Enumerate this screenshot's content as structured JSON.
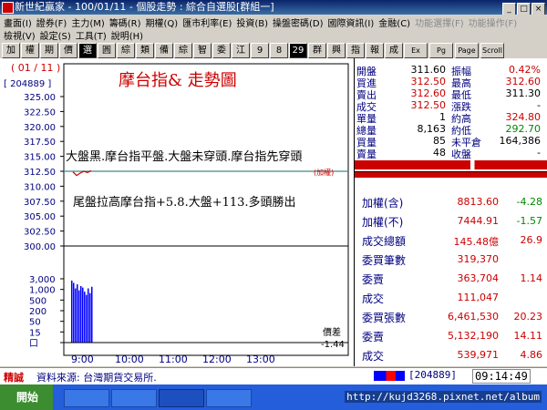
{
  "window": {
    "title": "新世紀贏家 - 100/01/11 - 個股走勢 : 綜合自選股[群組一]",
    "min_btn": "_",
    "max_btn": "□",
    "close_btn": "×"
  },
  "menu": {
    "row1": [
      "畫面(I)",
      "證券(F)",
      "主力(M)",
      "籌碼(R)",
      "期權(Q)",
      "匯市利率(E)",
      "投資(B)",
      "操盤密碼(D)",
      "國際資訊(I)",
      "金融(C)",
      "功能選擇(F)",
      "功能操作(F)"
    ],
    "row2": [
      "檢視(V)",
      "設定(S)",
      "工具(T)",
      "說明(H)"
    ]
  },
  "toolbar": {
    "buttons": [
      "加",
      "權",
      "期",
      "價",
      "選",
      "圓",
      "綜",
      "類",
      "備",
      "綜",
      "智",
      "委",
      "江",
      "9",
      "8",
      "29",
      "群",
      "興",
      "指",
      "報",
      "成",
      "Ex",
      "Pg",
      "Page",
      "Scroll"
    ]
  },
  "chart": {
    "date_label": "( 01 / 11 )",
    "code_label": "[ 204889 ]",
    "title": "摩台指&  走勢圖",
    "price_ticks": [
      "325.00",
      "322.50",
      "320.00",
      "317.50",
      "315.00",
      "312.50",
      "310.00",
      "307.50",
      "305.00",
      "302.50",
      "300.00"
    ],
    "volume_ticks": [
      "3,000",
      "1,000",
      "500",
      "200",
      "50",
      "15",
      "口"
    ],
    "time_ticks": [
      "9:00",
      "10:00",
      "11:00",
      "12:00",
      "13:00"
    ],
    "reference_label": "(加權)",
    "diff_label": "價差",
    "diff_value": "-1.44",
    "annotation1": "大盤黑.摩台指平盤.大盤未穿頭.摩台指先穿頭",
    "annotation2": "尾盤拉高摩台指+5.8.大盤+113.多頭勝出"
  },
  "chart_data": {
    "type": "line",
    "x": [
      "9:00",
      "9:02",
      "9:04",
      "9:06",
      "9:08",
      "9:10"
    ],
    "series": [
      {
        "values": [
          312.4,
          311.8,
          312.2,
          312.5,
          312.3,
          312.6
        ]
      }
    ],
    "ylim": [
      300,
      325
    ],
    "volume_bars": [
      2400,
      1800,
      900,
      1500,
      700,
      1200,
      1000,
      600,
      400,
      900,
      500,
      1100
    ],
    "reference_price": 312.5
  },
  "quote": {
    "rows": [
      {
        "l1": "開盤",
        "v1": "311.60",
        "l2": "振幅",
        "v2": "0.42%",
        "c1": "#000",
        "c2": "#c00"
      },
      {
        "l1": "買進",
        "v1": "312.50",
        "l2": "最高",
        "v2": "312.60",
        "c1": "#c00",
        "c2": "#c00"
      },
      {
        "l1": "賣出",
        "v1": "312.60",
        "l2": "最低",
        "v2": "311.30",
        "c1": "#c00",
        "c2": "#000"
      },
      {
        "l1": "成交",
        "v1": "312.50",
        "l2": "漲跌",
        "v2": "-",
        "c1": "#c00",
        "c2": "#000"
      },
      {
        "l1": "單量",
        "v1": "1",
        "l2": "約高",
        "v2": "324.80",
        "c1": "#000",
        "c2": "#c00"
      },
      {
        "l1": "總量",
        "v1": "8,163",
        "l2": "約低",
        "v2": "292.70",
        "c1": "#000",
        "c2": "#080"
      },
      {
        "l1": "買量",
        "v1": "85",
        "l2": "未平倉",
        "v2": "164,386",
        "c1": "#000",
        "c2": "#000"
      },
      {
        "l1": "賣量",
        "v1": "48",
        "l2": "收盤",
        "v2": "-",
        "c1": "#000",
        "c2": "#000"
      }
    ]
  },
  "broad": {
    "rows": [
      {
        "label": "加權(含)",
        "value": "8813.60",
        "chg": "-4.28"
      },
      {
        "label": "加權(不)",
        "value": "7444.91",
        "chg": "-1.57"
      },
      {
        "label": "成交總額",
        "value": "145.48億",
        "chg": "26.9"
      },
      {
        "label": "委買筆數",
        "value": "319,370",
        "chg": ""
      },
      {
        "label": "委賣",
        "value": "363,704",
        "chg": "1.14"
      },
      {
        "label": "成交",
        "value": "111,047",
        "chg": ""
      },
      {
        "label": "委買張數",
        "value": "6,461,530",
        "chg": "20.23"
      },
      {
        "label": "委賣",
        "value": "5,132,190",
        "chg": "14.11"
      },
      {
        "label": "成交",
        "value": "539,971",
        "chg": "4.86"
      }
    ]
  },
  "status": {
    "left": "精誠",
    "source": "資料來源: 台灣期貨交易所.",
    "code": "204889",
    "time": "09:14:49"
  },
  "taskbar": {
    "start": "開始",
    "url": "http://kujd3268.pixnet.net/album"
  }
}
